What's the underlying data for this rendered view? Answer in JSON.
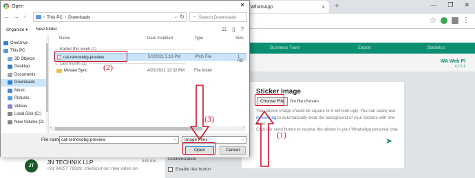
{
  "browser": {
    "tab_title": "WhatsApp",
    "tab_close": "×",
    "new_tab": "+",
    "window_controls": [
      "—",
      "❐",
      "✕"
    ],
    "toolbar_icons": [
      "star-icon",
      "extension-icon",
      "profile-icon",
      "menu-icon"
    ]
  },
  "app": {
    "nav": [
      "Business Tools",
      "Export",
      "Statistics"
    ],
    "brand": "WA Web Pl",
    "version": "4.7.5.1",
    "sticker": {
      "title": "Sticker image",
      "choose_label": "Choose File",
      "no_file": "No file chosen",
      "desc_pre": "Your sticker image should be square or it will look ugly. You can easily use ",
      "desc_link": "remove.bg",
      "desc_post": " to automatically clear the background of your stickers with one click!",
      "click_text": "Click the send button to receive the sticker in your WhatsApp personal chat"
    },
    "contact": {
      "initials": "JT",
      "name": "JN TECHNIX LLP",
      "time": "9:53 AM",
      "message": "+91 94257 78939: checkout our new video on:"
    },
    "settings": {
      "heading": "Customization",
      "option": "Enable like button"
    }
  },
  "dialog": {
    "title": "Open",
    "close": "✕",
    "path": [
      "This PC",
      "Downloads"
    ],
    "search_placeholder": "Search Downloads",
    "organize": "Organize ▾",
    "new_folder": "New folder",
    "columns": {
      "name": "Name",
      "date": "Date modified",
      "type": "Type",
      "size": "Size"
    },
    "nav": [
      {
        "label": "OneDrive",
        "color": "#2f7fd6"
      },
      {
        "label": "This PC",
        "color": "#5e9ad6"
      },
      {
        "label": "3D Objects",
        "color": "#7aa8d8"
      },
      {
        "label": "Desktop",
        "color": "#3b78c4"
      },
      {
        "label": "Documents",
        "color": "#9aa6b4"
      },
      {
        "label": "Downloads",
        "color": "#2f7fd6"
      },
      {
        "label": "Music",
        "color": "#4a84c9"
      },
      {
        "label": "Pictures",
        "color": "#5aa0d8"
      },
      {
        "label": "Videos",
        "color": "#8a7cc9"
      },
      {
        "label": "Local Disk (C:)",
        "color": "#888888"
      },
      {
        "label": "New Volume (D:",
        "color": "#888888"
      }
    ],
    "groups": [
      {
        "label": "Earlier this week (1)",
        "files": [
          {
            "name": "cat-removebg-preview",
            "date": "5/3/2021 5:18 PM",
            "type": "PNG File",
            "size": "1 KB"
          }
        ]
      },
      {
        "label": "Last month (1)",
        "files": [
          {
            "name": "Movavi Sync",
            "date": "4/22/2021 12:32 PM",
            "type": "File folder",
            "size": ""
          }
        ]
      }
    ],
    "file_name_label": "File name:",
    "file_name_value": "cat-removebg-preview",
    "file_type": "Image Files",
    "open_label": "Open",
    "cancel_label": "Cancel"
  },
  "annotations": {
    "step1": "(1)",
    "step2": "(2)",
    "step3": "(3)",
    "color": "#d0122b"
  }
}
